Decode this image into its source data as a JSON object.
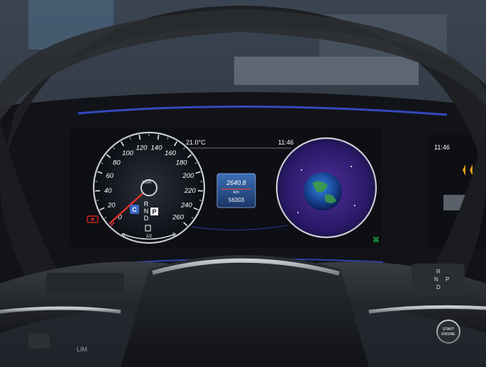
{
  "cluster": {
    "temperature": "21.0°C",
    "time": "11:46",
    "odometer_trip": "2640.8",
    "odometer_unit": "km",
    "odometer_total": "56303",
    "speed_unit": "km/h",
    "speed_ticks": [
      "0",
      "20",
      "40",
      "60",
      "80",
      "100",
      "120",
      "140",
      "160",
      "180",
      "200",
      "220",
      "240",
      "260"
    ],
    "gear_letters": [
      "R",
      "N",
      "D"
    ],
    "gear_selected": "P",
    "drive_mode_badge": "C",
    "fuel_scale": {
      "left": "0",
      "mid": "1/2",
      "right": "1"
    },
    "needle_speed_kmh": 0
  },
  "side_display": {
    "time": "11:46"
  },
  "gear_selector": {
    "letters": [
      "R",
      "N",
      "D",
      "P"
    ]
  },
  "controls": {
    "start_button_label": "START\nENGINE",
    "lim_label": "LIM"
  },
  "colors": {
    "accent_blue": "#3a4fd0",
    "needle_red": "#e0342a",
    "screen_bg": "#0d0f14",
    "warning_red": "#d22020",
    "status_green": "#2bd35a"
  }
}
